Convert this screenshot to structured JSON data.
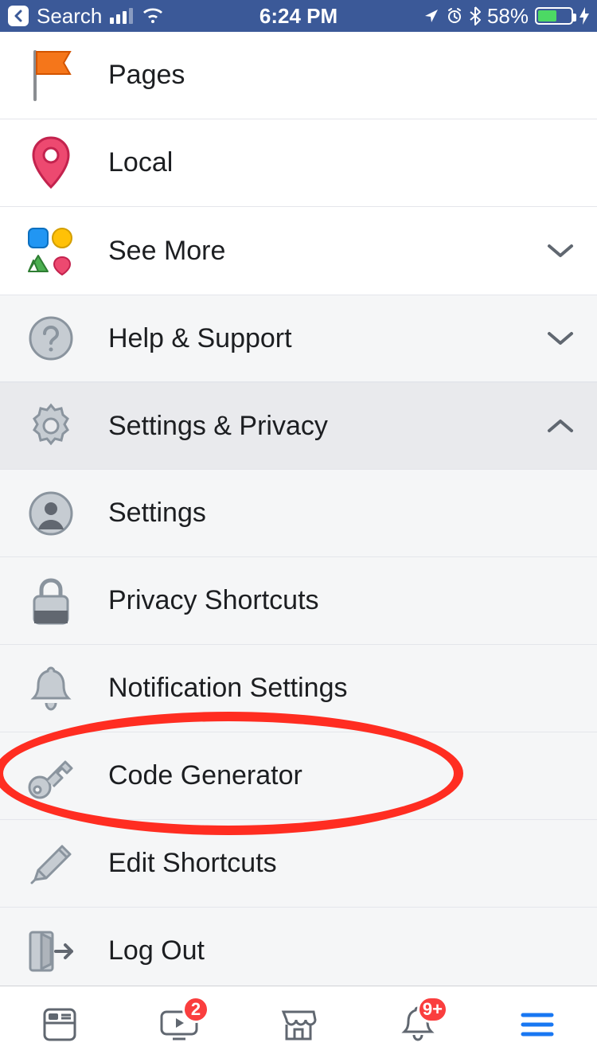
{
  "status": {
    "back_label": "Search",
    "time": "6:24 PM",
    "battery_pct": "58%"
  },
  "menu": {
    "pages": "Pages",
    "local": "Local",
    "see_more": "See More",
    "help": "Help & Support",
    "settings_privacy": "Settings & Privacy",
    "settings": "Settings",
    "privacy_shortcuts": "Privacy Shortcuts",
    "notification_settings": "Notification Settings",
    "code_generator": "Code Generator",
    "edit_shortcuts": "Edit Shortcuts",
    "log_out": "Log Out"
  },
  "tabs": {
    "video_badge": "2",
    "notif_badge": "9+"
  }
}
